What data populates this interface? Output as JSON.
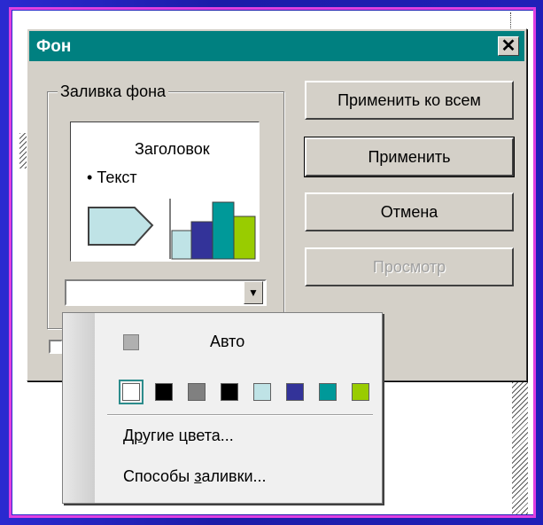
{
  "dialog": {
    "title": "Фон",
    "close_glyph": "✕",
    "group_label": "Заливка фона",
    "preview": {
      "title": "Заголовок",
      "text_bullet": "•",
      "text": "Текст"
    },
    "buttons": {
      "apply_all": "Применить ко всем",
      "apply": "Применить",
      "cancel": "Отмена",
      "preview": "Просмотр"
    }
  },
  "popup": {
    "auto_label": "Авто",
    "swatches": [
      "#ffffff",
      "#000000",
      "#808080",
      "#000000",
      "#bfe3e6",
      "#333399",
      "#009999",
      "#99cc00"
    ],
    "more_colors_prefix": "Д",
    "more_colors_underlined": "р",
    "more_colors_suffix": "угие цвета...",
    "fill_effects_prefix": "Способы ",
    "fill_effects_underlined": "з",
    "fill_effects_suffix": "аливки..."
  },
  "colors": {
    "titlebar": "#008080",
    "dialog_bg": "#d4d0c8",
    "frame_pink": "#e040e0",
    "background_blue": "#1c1ca8"
  }
}
